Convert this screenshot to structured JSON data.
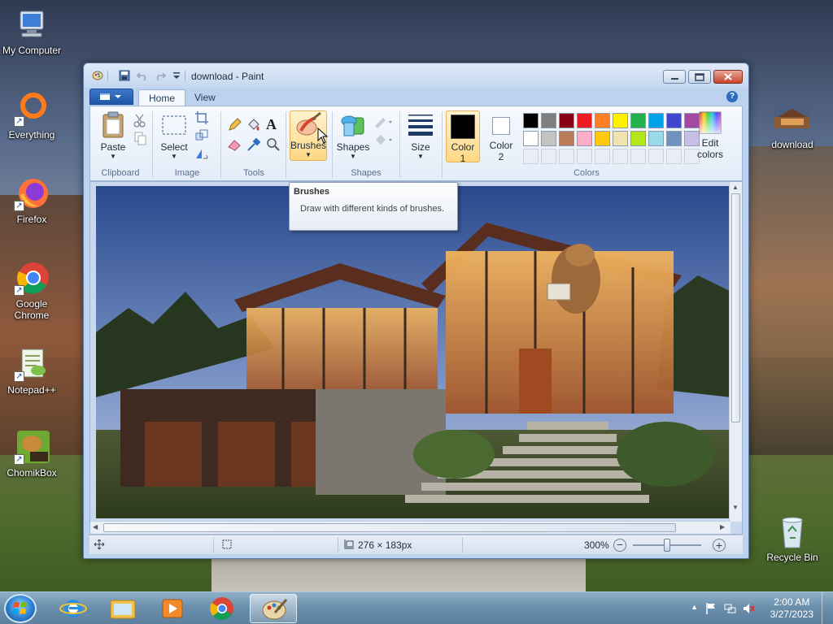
{
  "desktop": {
    "icons": [
      {
        "label": "My Computer"
      },
      {
        "label": "Everything"
      },
      {
        "label": "Firefox"
      },
      {
        "label": "Google Chrome"
      },
      {
        "label": "Notepad++"
      },
      {
        "label": "ChomikBox"
      },
      {
        "label": "download"
      },
      {
        "label": "Recycle Bin"
      }
    ]
  },
  "window": {
    "title": "download - Paint",
    "tabs": [
      {
        "label": "Home"
      },
      {
        "label": "View"
      }
    ],
    "help_label": "?",
    "ribbon": {
      "clipboard": {
        "paste_label": "Paste",
        "group_label": "Clipboard"
      },
      "image": {
        "select_label": "Select",
        "group_label": "Image"
      },
      "tools": {
        "group_label": "Tools",
        "text_tool_glyph": "A"
      },
      "brushes_label": "Brushes",
      "shapes": {
        "shapes_label": "Shapes",
        "group_label": "Shapes"
      },
      "size_label": "Size",
      "color1": {
        "label_line1": "Color",
        "label_line2": "1",
        "color": "#000000"
      },
      "color2": {
        "label_line1": "Color",
        "label_line2": "2",
        "color": "#ffffff"
      },
      "colors_group_label": "Colors",
      "edit_colors_line1": "Edit",
      "edit_colors_line2": "colors",
      "palette_row1": [
        "#000000",
        "#7f7f7f",
        "#880015",
        "#ed1c24",
        "#ff7f27",
        "#fff200",
        "#22b14c",
        "#00a2e8",
        "#3f48cc",
        "#a349a4"
      ],
      "palette_row2": [
        "#ffffff",
        "#c3c3c3",
        "#b97a57",
        "#ffaec9",
        "#ffc90e",
        "#efe4b0",
        "#b5e61d",
        "#99d9ea",
        "#7092be",
        "#c8bfe7"
      ]
    },
    "tooltip": {
      "title": "Brushes",
      "body": "Draw with different kinds of brushes."
    },
    "status": {
      "image_size": "276 × 183px",
      "zoom": "300%",
      "zoom_level": 0.5
    }
  },
  "taskbar": {
    "time": "2:00 AM",
    "date": "3/27/2023"
  }
}
